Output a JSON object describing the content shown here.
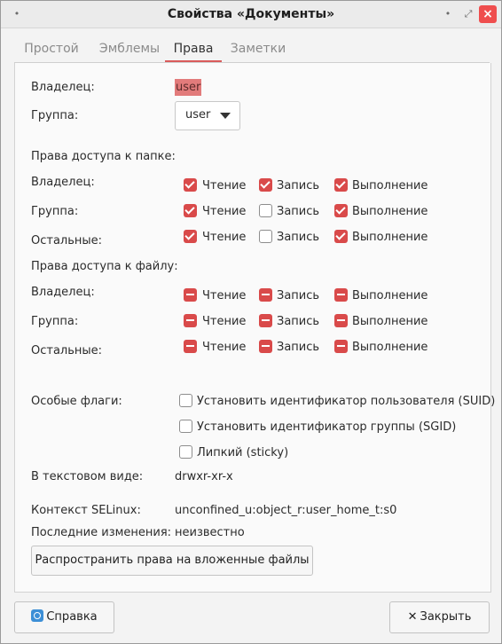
{
  "window": {
    "title": "Свойства «Документы»",
    "accent": "#d94a4a"
  },
  "tabs": [
    {
      "label": "Простой",
      "active": false
    },
    {
      "label": "Эмблемы",
      "active": false
    },
    {
      "label": "Права",
      "active": true
    },
    {
      "label": "Заметки",
      "active": false
    }
  ],
  "owner": {
    "label": "Владелец:",
    "value": "user"
  },
  "group": {
    "label": "Группа:",
    "value": "user"
  },
  "folder_access": {
    "title": "Права доступа к папке:",
    "rows": [
      {
        "label": "Владелец:",
        "perms": [
          {
            "label": "Чтение",
            "state": "checked"
          },
          {
            "label": "Запись",
            "state": "checked"
          },
          {
            "label": "Выполнение",
            "state": "checked"
          }
        ]
      },
      {
        "label": "Группа:",
        "perms": [
          {
            "label": "Чтение",
            "state": "checked"
          },
          {
            "label": "Запись",
            "state": "unchecked"
          },
          {
            "label": "Выполнение",
            "state": "checked"
          }
        ]
      },
      {
        "label": "Остальные:",
        "perms": [
          {
            "label": "Чтение",
            "state": "checked"
          },
          {
            "label": "Запись",
            "state": "unchecked"
          },
          {
            "label": "Выполнение",
            "state": "checked"
          }
        ]
      }
    ]
  },
  "file_access": {
    "title": "Права доступа к файлу:",
    "rows": [
      {
        "label": "Владелец:",
        "perms": [
          {
            "label": "Чтение",
            "state": "inconsistent"
          },
          {
            "label": "Запись",
            "state": "inconsistent"
          },
          {
            "label": "Выполнение",
            "state": "inconsistent"
          }
        ]
      },
      {
        "label": "Группа:",
        "perms": [
          {
            "label": "Чтение",
            "state": "inconsistent"
          },
          {
            "label": "Запись",
            "state": "inconsistent"
          },
          {
            "label": "Выполнение",
            "state": "inconsistent"
          }
        ]
      },
      {
        "label": "Остальные:",
        "perms": [
          {
            "label": "Чтение",
            "state": "inconsistent"
          },
          {
            "label": "Запись",
            "state": "inconsistent"
          },
          {
            "label": "Выполнение",
            "state": "inconsistent"
          }
        ]
      }
    ]
  },
  "special_flags": {
    "label": "Особые флаги:",
    "options": [
      {
        "label": "Установить идентификатор пользователя (SUID)",
        "state": "unchecked"
      },
      {
        "label": "Установить идентификатор группы (SGID)",
        "state": "unchecked"
      },
      {
        "label": "Липкий (sticky)",
        "state": "unchecked"
      }
    ]
  },
  "text_view": {
    "label": "В текстовом виде:",
    "value": "drwxr-xr-x"
  },
  "selinux": {
    "label": "Контекст SELinux:",
    "value": "unconfined_u:object_r:user_home_t:s0"
  },
  "last_changed": {
    "label": "Последние изменения:",
    "value": "неизвестно"
  },
  "apply_recursive_label": "Распространить права на вложенные файлы",
  "footer": {
    "help_label": "Справка",
    "close_label": "Закрыть"
  }
}
